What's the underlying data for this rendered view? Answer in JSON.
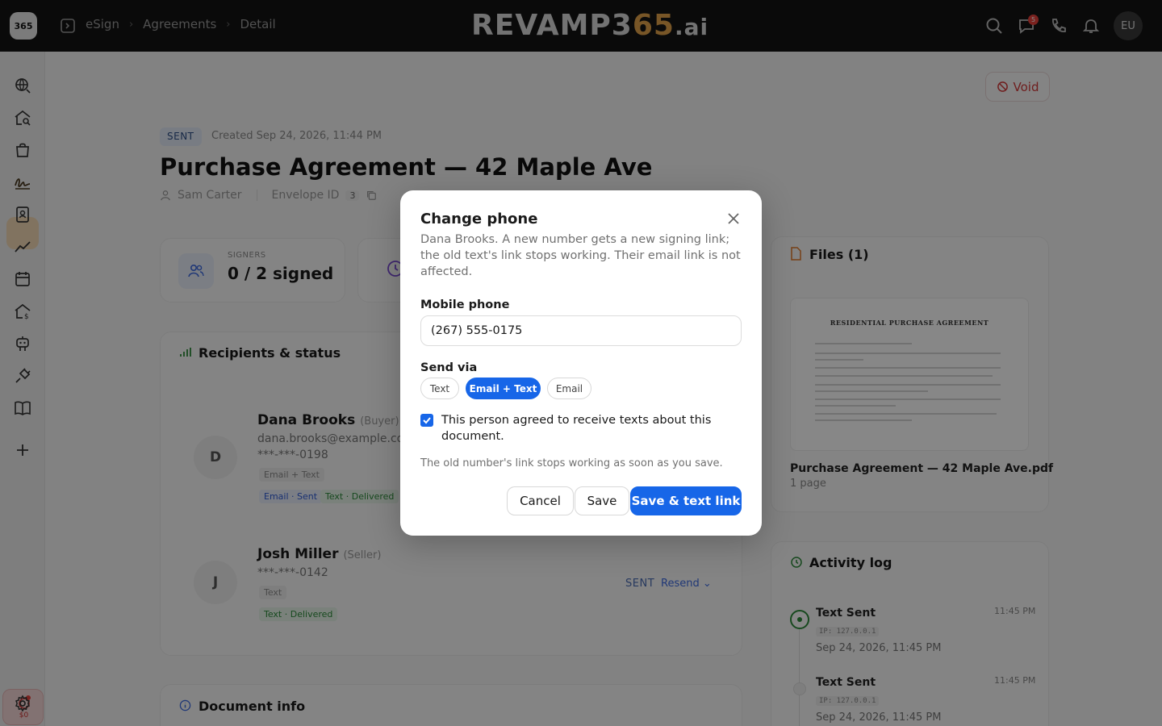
{
  "topbar": {
    "logo_text": "365",
    "breadcrumbs": [
      "eSign",
      "Agreements",
      "Detail"
    ],
    "brand": {
      "main": "REVAMP3",
      "accent": "65",
      "suffix": ".ai"
    },
    "notification_count": "5",
    "avatar_initials": "EU",
    "icons": [
      "search-icon",
      "chat-icon",
      "phone-icon",
      "bell-icon"
    ]
  },
  "sidebar": {
    "icons": [
      "globe-search-icon",
      "home-search-icon",
      "bag-icon",
      "signature-icon",
      "contacts-icon",
      "chart-line-icon",
      "calendar-icon",
      "home-dollar-icon",
      "robot-icon",
      "plug-icon",
      "book-icon",
      "plus-icon",
      "settings-icon"
    ],
    "active_item": "signature-icon",
    "credits": "$0"
  },
  "document": {
    "status": "SENT",
    "created": "Created Sep 24, 2026, 11:44 PM",
    "title": "Purchase Agreement — 42 Maple Ave",
    "owner": "Sam Carter",
    "envelope_label": "Envelope ID",
    "envelope_count": "3",
    "void_label": "Void"
  },
  "stats": {
    "signers_label": "SIGNERS",
    "signers_value": "0 / 2 signed"
  },
  "recipients": {
    "title": "Recipients & status",
    "items": [
      {
        "initial": "D",
        "name": "Dana Brooks",
        "role": "(Buyer)",
        "email": "dana.brooks@example.co",
        "phone": "***-***-0198",
        "channel": "Email + Text",
        "statuses": [
          "Email · Sent",
          "Text · Delivered"
        ]
      },
      {
        "initial": "J",
        "name": "Josh Miller",
        "role": "(Seller)",
        "phone": "***-***-0142",
        "channel": "Text",
        "statuses": [
          "Text · Delivered"
        ],
        "state": "SENT",
        "action": "Resend"
      }
    ]
  },
  "document_info": {
    "title": "Document info"
  },
  "files": {
    "title": "Files (1)",
    "preview_heading": "RESIDENTIAL PURCHASE AGREEMENT",
    "file_name": "Purchase Agreement — 42 Maple Ave.pdf",
    "pages": "1 page"
  },
  "activity": {
    "title": "Activity log",
    "items": [
      {
        "event": "Text Sent",
        "ip": "IP: 127.0.0.1",
        "date": "Sep 24, 2026, 11:45 PM",
        "time": "11:45 PM"
      },
      {
        "event": "Text Sent",
        "ip": "IP: 127.0.0.1",
        "date": "Sep 24, 2026, 11:45 PM",
        "time": "11:45 PM"
      }
    ]
  },
  "modal": {
    "title": "Change phone",
    "description": "Dana Brooks. A new number gets a new signing link; the old text's link stops working. Their email link is not affected.",
    "phone_label": "Mobile phone",
    "phone_value": "(267) 555-0175",
    "send_via_label": "Send via",
    "send_options": [
      "Text",
      "Email + Text",
      "Email"
    ],
    "selected_option": "Email + Text",
    "consent_checked": true,
    "consent_label": "This person agreed to receive texts about this document.",
    "note": "The old number's link stops working as soon as you save.",
    "cancel_label": "Cancel",
    "save_label": "Save",
    "save_text_label": "Save & text link",
    "accent_color": "#1766e8"
  }
}
